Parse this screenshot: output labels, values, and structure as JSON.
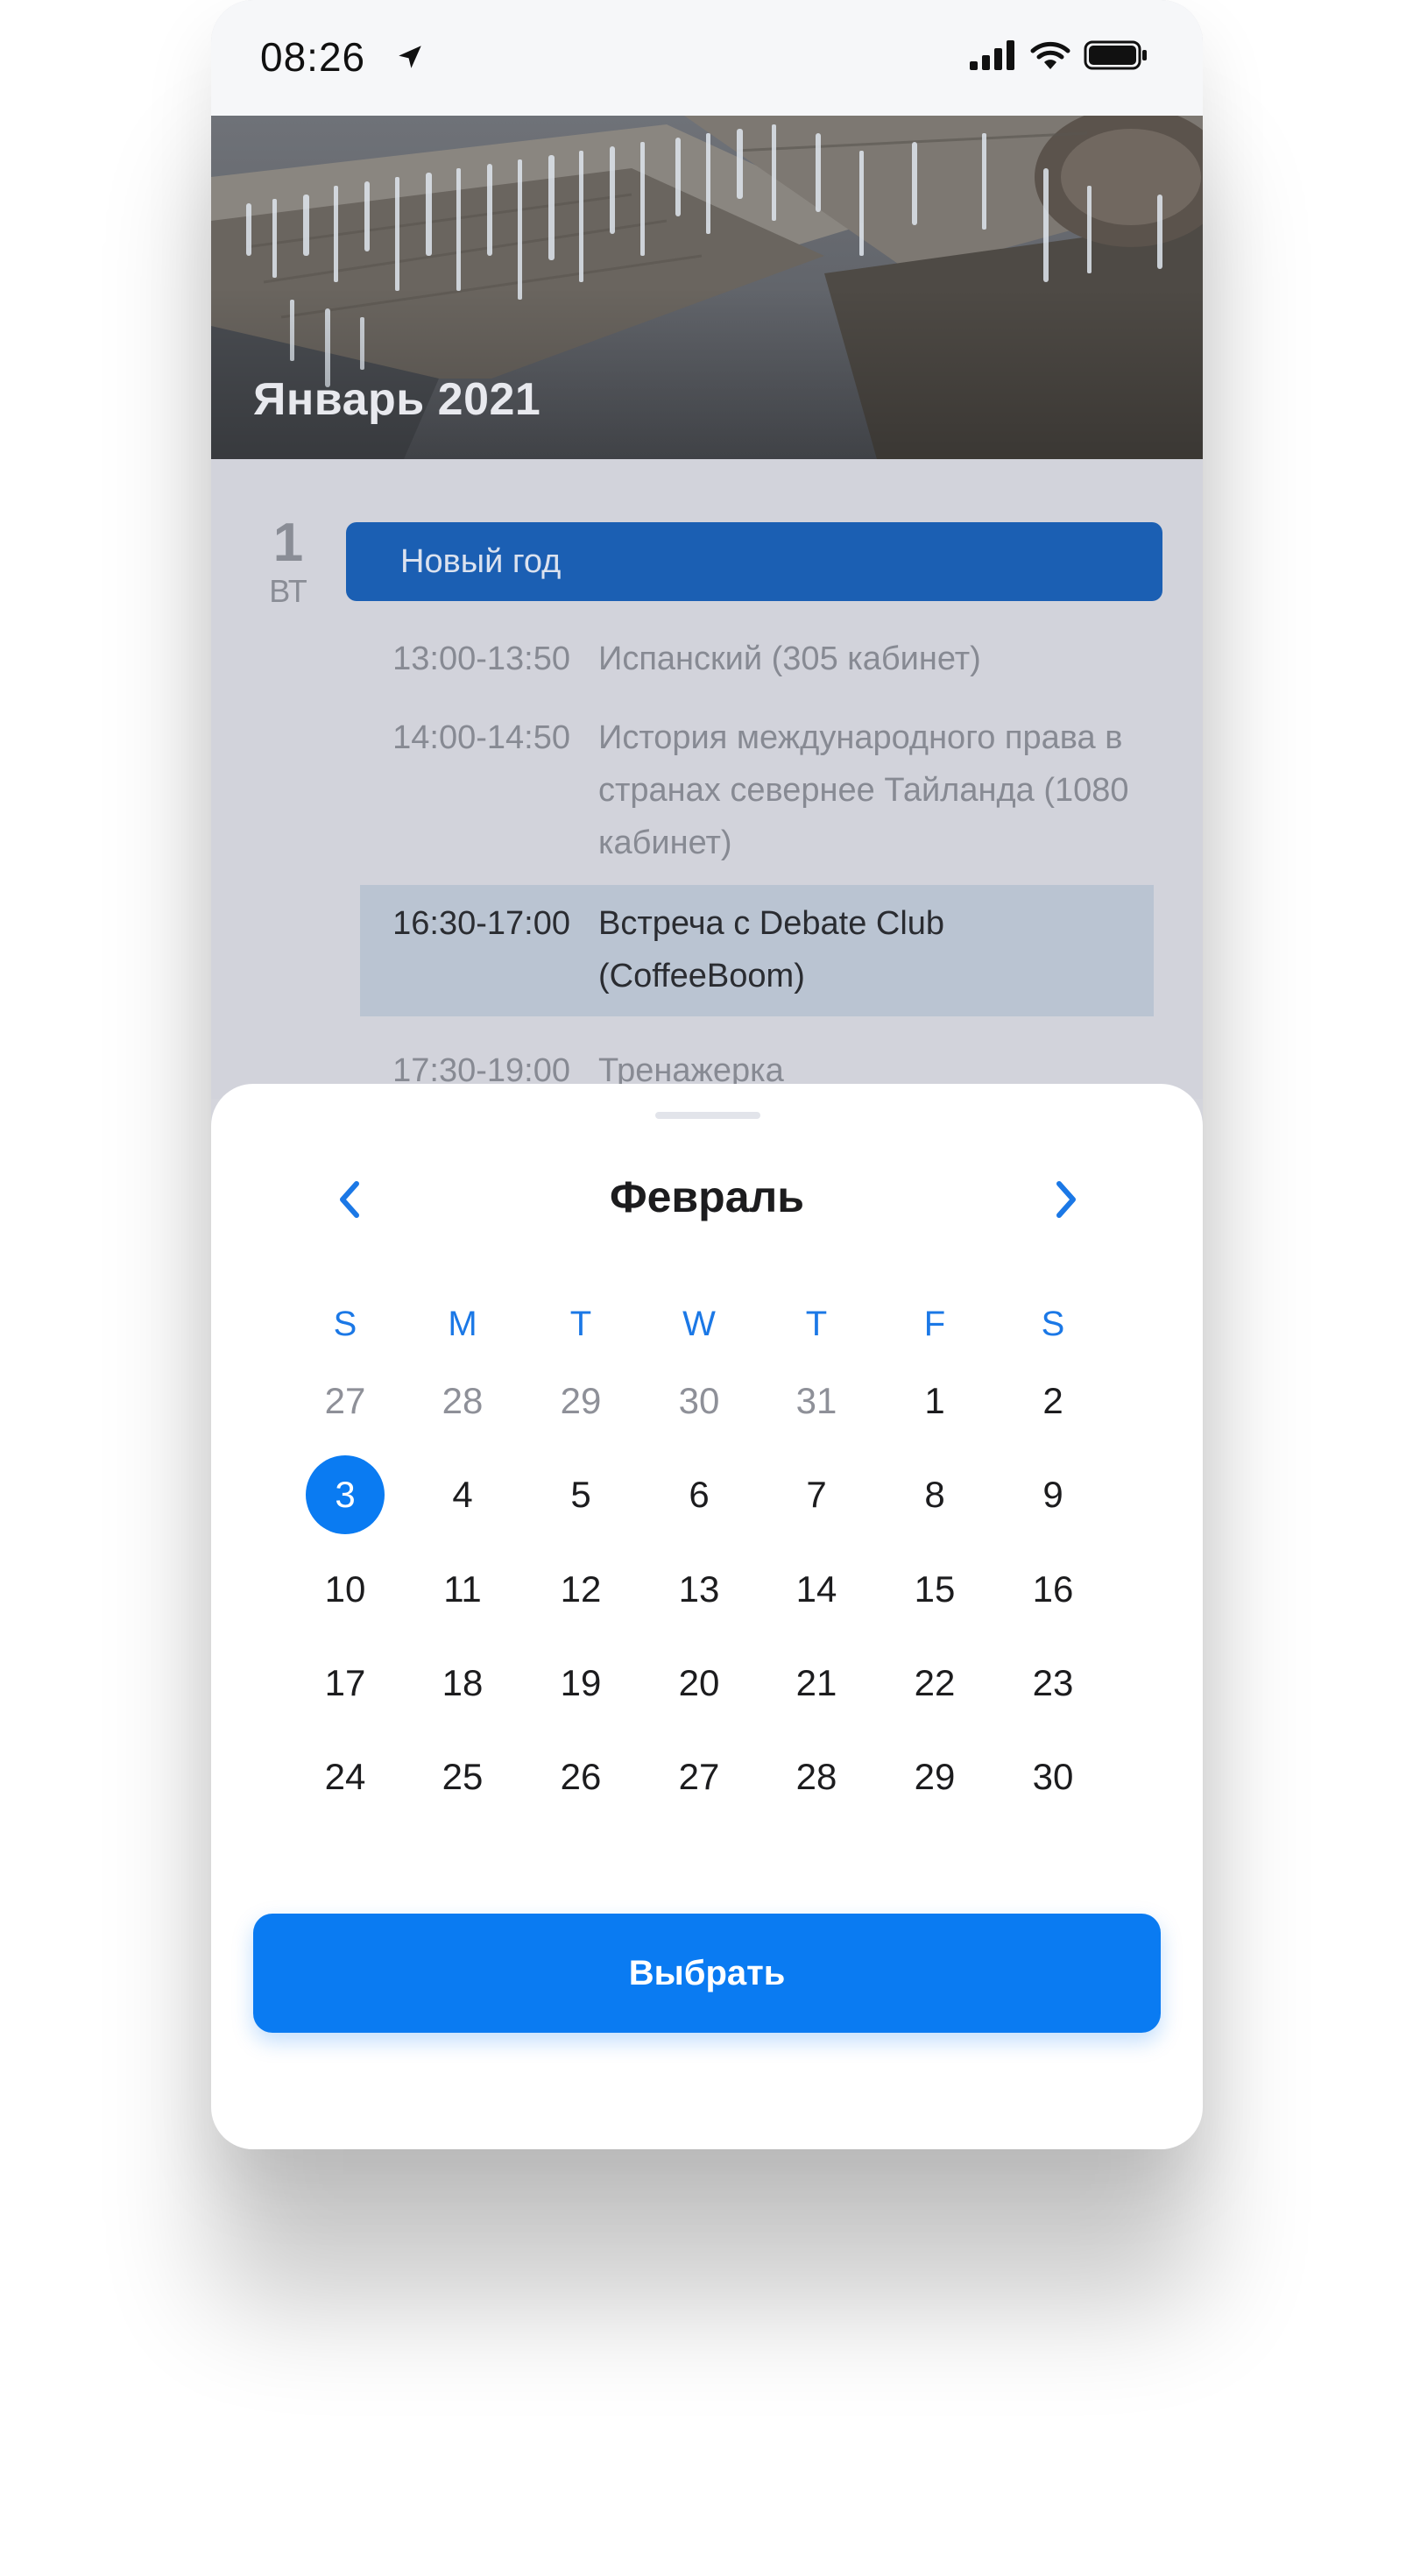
{
  "status_bar": {
    "time": "08:26"
  },
  "header": {
    "title": "Январь 2021"
  },
  "schedule": {
    "day_number": "1",
    "weekday": "ВТ",
    "holiday": "Новый год",
    "events": [
      {
        "time": "13:00-13:50",
        "name": "Испанский (305 кабинет)"
      },
      {
        "time": "14:00-14:50",
        "name": "История международного права в странах севернее Тайланда (1080 кабинет)"
      },
      {
        "time": "16:30-17:00",
        "name": "Встреча с Debate Club (CoffeeBoom)",
        "highlighted": true
      },
      {
        "time": "17:30-19:00",
        "name": "Тренажерка"
      }
    ]
  },
  "calendar": {
    "month": "Февраль",
    "weekdays": [
      "S",
      "M",
      "T",
      "W",
      "T",
      "F",
      "S"
    ],
    "weeks": [
      [
        "27",
        "28",
        "29",
        "30",
        "31",
        "1",
        "2"
      ],
      [
        "3",
        "4",
        "5",
        "6",
        "7",
        "8",
        "9"
      ],
      [
        "10",
        "11",
        "12",
        "13",
        "14",
        "15",
        "16"
      ],
      [
        "17",
        "18",
        "19",
        "20",
        "21",
        "22",
        "23"
      ],
      [
        "24",
        "25",
        "26",
        "27",
        "28",
        "29",
        "30"
      ]
    ],
    "selected_day": "3",
    "select_button": "Выбрать"
  },
  "colors": {
    "accent": "#0A7BF2",
    "holiday": "#1B5FB3",
    "highlight_row": "#BAC4D2"
  }
}
